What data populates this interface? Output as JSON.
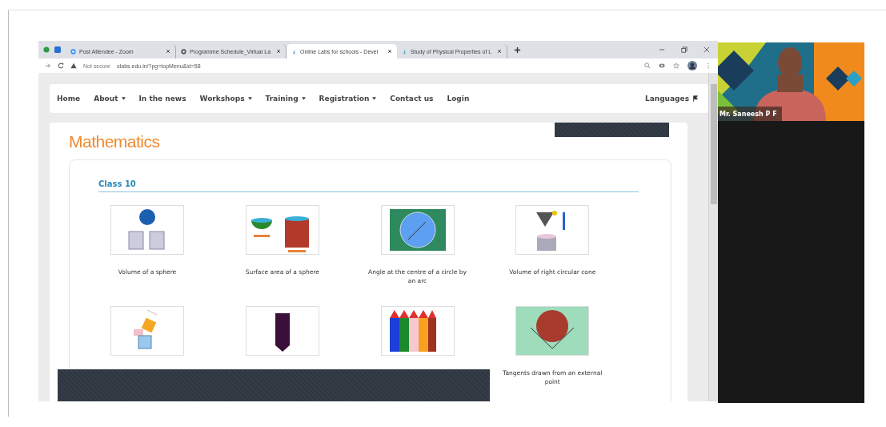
{
  "browser": {
    "tabs": [
      {
        "title": "Post Attendee - Zoom",
        "selected": false
      },
      {
        "title": "Programme Schedule_Virtual La",
        "selected": false
      },
      {
        "title": "Online Labs for schools - Devel",
        "selected": true
      },
      {
        "title": "Study of Physical Properties of L",
        "selected": false
      }
    ],
    "security": "Not secure",
    "url": "olabs.edu.in/?pg=topMenu&id=58"
  },
  "nav": {
    "items": [
      {
        "label": "Home",
        "has_menu": false
      },
      {
        "label": "About",
        "has_menu": true
      },
      {
        "label": "In the news",
        "has_menu": false
      },
      {
        "label": "Workshops",
        "has_menu": true
      },
      {
        "label": "Training",
        "has_menu": true
      },
      {
        "label": "Registration",
        "has_menu": true
      },
      {
        "label": "Contact us",
        "has_menu": false
      },
      {
        "label": "Login",
        "has_menu": false
      }
    ],
    "languages": "Languages"
  },
  "page": {
    "heading": "Mathematics",
    "section": "Class 10",
    "labs": [
      {
        "kind": "sphere",
        "title": "Volume of a sphere"
      },
      {
        "kind": "hemisphere",
        "title": "Surface area of a sphere"
      },
      {
        "kind": "arc",
        "title": "Angle at the centre of a circle by an arc"
      },
      {
        "kind": "cone",
        "title": "Volume of right circular cone"
      },
      {
        "kind": "squares"
      },
      {
        "kind": "cylinder"
      },
      {
        "kind": "crayons"
      },
      {
        "kind": "tangents",
        "title": "Tangents drawn from an external point"
      }
    ]
  },
  "video": {
    "kind": "picture",
    "participant": "Mr. Saneesh P F"
  }
}
